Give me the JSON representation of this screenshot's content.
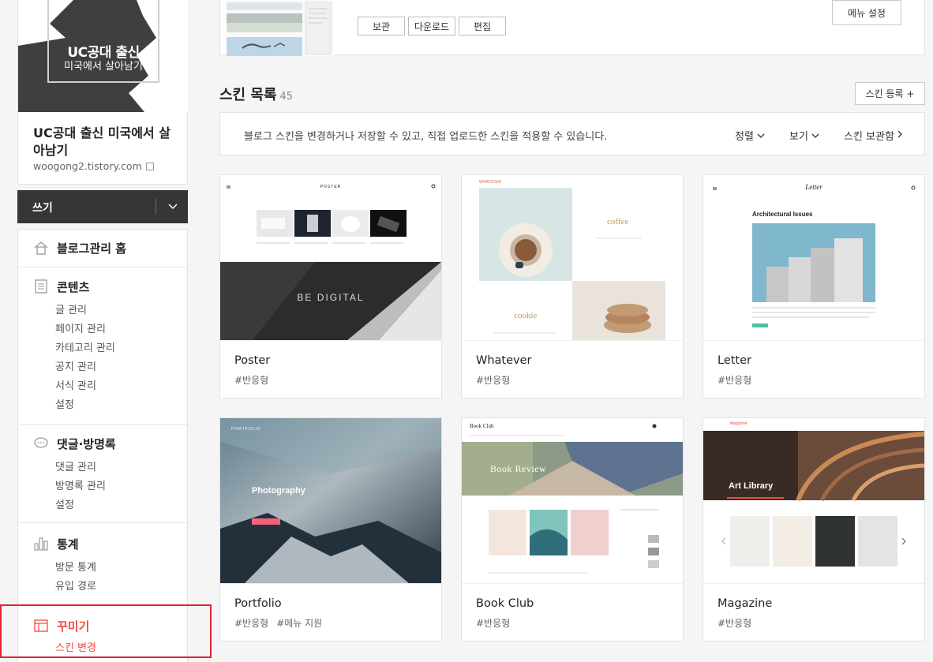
{
  "blog": {
    "thumb_title": "UC공대 출신",
    "thumb_subtitle": "미국에서 살아남기",
    "name": "UC공대 출신 미국에서 살아남기",
    "url": "woogong2.tistory.com"
  },
  "write": {
    "label": "쓰기"
  },
  "menu": {
    "home": "블로그관리 홈",
    "content": {
      "title": "콘텐츠",
      "items": [
        "글 관리",
        "페이지 관리",
        "카테고리 관리",
        "공지 관리",
        "서식 관리",
        "설정"
      ]
    },
    "comments": {
      "title": "댓글·방명록",
      "items": [
        "댓글 관리",
        "방명록 관리",
        "설정"
      ]
    },
    "stats": {
      "title": "통계",
      "items": [
        "방문 통계",
        "유입 경로"
      ]
    },
    "decorate": {
      "title": "꾸미기",
      "items": [
        "스킨 변경"
      ]
    }
  },
  "current_skin": {
    "buttons": [
      "보관",
      "다운로드",
      "편집"
    ],
    "menu_settings": "메뉴 설정"
  },
  "skin_list": {
    "title": "스킨 목록",
    "count": "45",
    "register": "스킨 등록 +",
    "info": "블로그 스킨을 변경하거나 저장할 수 있고, 직접 업로드한 스킨을 적용할 수 있습니다.",
    "sort": "정렬",
    "view": "보기",
    "archive": "스킨 보관함"
  },
  "skins": [
    {
      "name": "Poster",
      "tags": [
        "#반응형"
      ],
      "preview_label": "POSTER",
      "preview_heading": "BE DIGITAL"
    },
    {
      "name": "Whatever",
      "tags": [
        "#반응형"
      ],
      "preview_label": "WHATEVER",
      "preview_heading": "coffee",
      "preview_sub": "cookie"
    },
    {
      "name": "Letter",
      "tags": [
        "#반응형"
      ],
      "preview_label": "Letter",
      "preview_heading": "Architectural Issues"
    },
    {
      "name": "Portfolio",
      "tags": [
        "#반응형",
        "#메뉴 지원"
      ],
      "preview_label": "PORTFOLIO",
      "preview_heading": "Photography"
    },
    {
      "name": "Book Club",
      "tags": [
        "#반응형"
      ],
      "preview_label": "Book Club",
      "preview_heading": "Book Review"
    },
    {
      "name": "Magazine",
      "tags": [
        "#반응형"
      ],
      "preview_label": "Magazine",
      "preview_heading": "Art Library"
    }
  ],
  "colors": {
    "accent": "#f5493d",
    "dark": "#363636",
    "highlight": "#e0242d"
  }
}
